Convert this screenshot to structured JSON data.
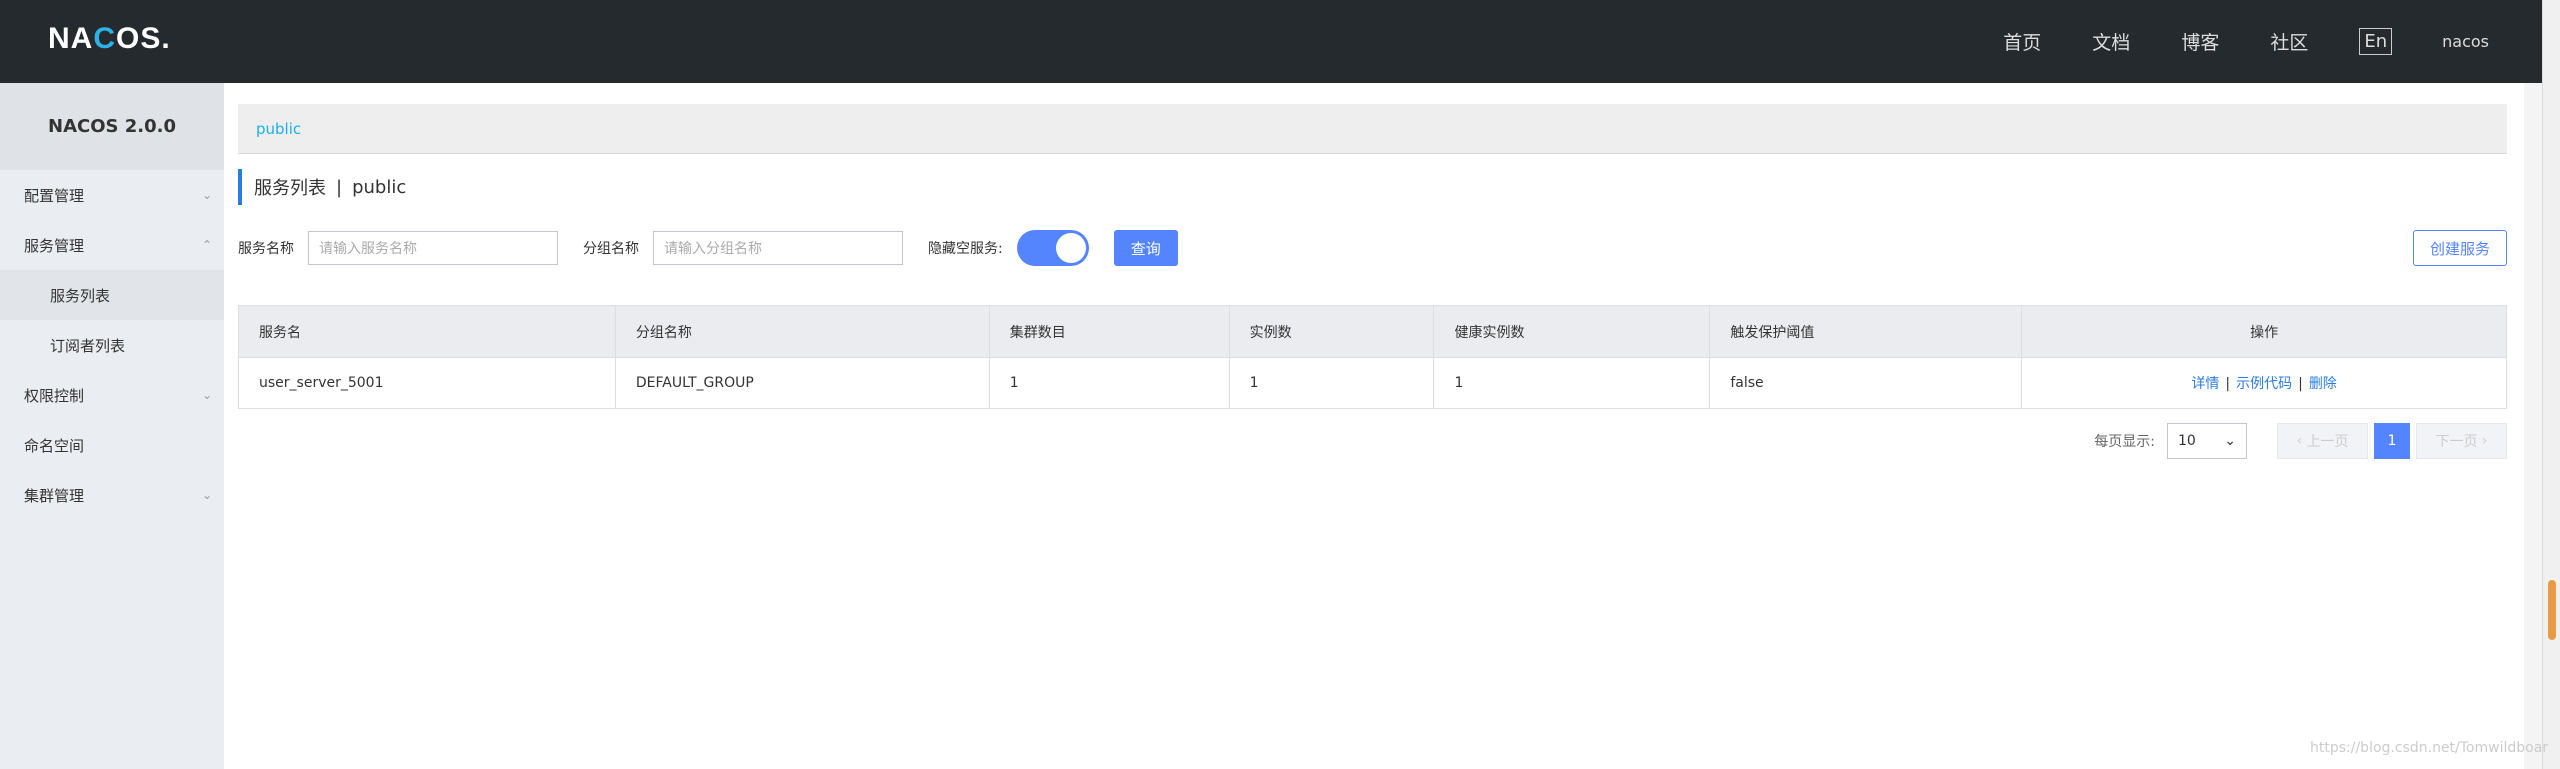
{
  "header": {
    "logo": "NACOS.",
    "nav": [
      "首页",
      "文档",
      "博客",
      "社区"
    ],
    "lang": "En",
    "user": "nacos"
  },
  "sidebar": {
    "version": "NACOS 2.0.0",
    "items": [
      {
        "label": "配置管理",
        "chevron": "⌄"
      },
      {
        "label": "服务管理",
        "chevron": "⌃"
      },
      {
        "label": "服务列表",
        "chevron": ""
      },
      {
        "label": "订阅者列表",
        "chevron": ""
      },
      {
        "label": "权限控制",
        "chevron": "⌄"
      },
      {
        "label": "命名空间",
        "chevron": ""
      },
      {
        "label": "集群管理",
        "chevron": "⌄"
      }
    ]
  },
  "breadcrumb": "public",
  "page_title": {
    "main": "服务列表",
    "sep": "|",
    "namespace": "public"
  },
  "filters": {
    "service_label": "服务名称",
    "service_placeholder": "请输入服务名称",
    "group_label": "分组名称",
    "group_placeholder": "请输入分组名称",
    "hide_empty_label": "隐藏空服务:",
    "hide_empty_on": true,
    "query_button": "查询",
    "create_button": "创建服务"
  },
  "table": {
    "headers": [
      "服务名",
      "分组名称",
      "集群数目",
      "实例数",
      "健康实例数",
      "触发保护阈值",
      "操作"
    ],
    "rows": [
      {
        "name": "user_server_5001",
        "group": "DEFAULT_GROUP",
        "clusters": "1",
        "instances": "1",
        "healthy": "1",
        "threshold": "false",
        "actions": [
          "详情",
          "示例代码",
          "删除"
        ]
      }
    ]
  },
  "pagination": {
    "per_page_label": "每页显示:",
    "per_page": "10",
    "prev": "上一页",
    "current": "1",
    "next": "下一页"
  },
  "watermark": "https://blog.csdn.net/Tomwildboar"
}
